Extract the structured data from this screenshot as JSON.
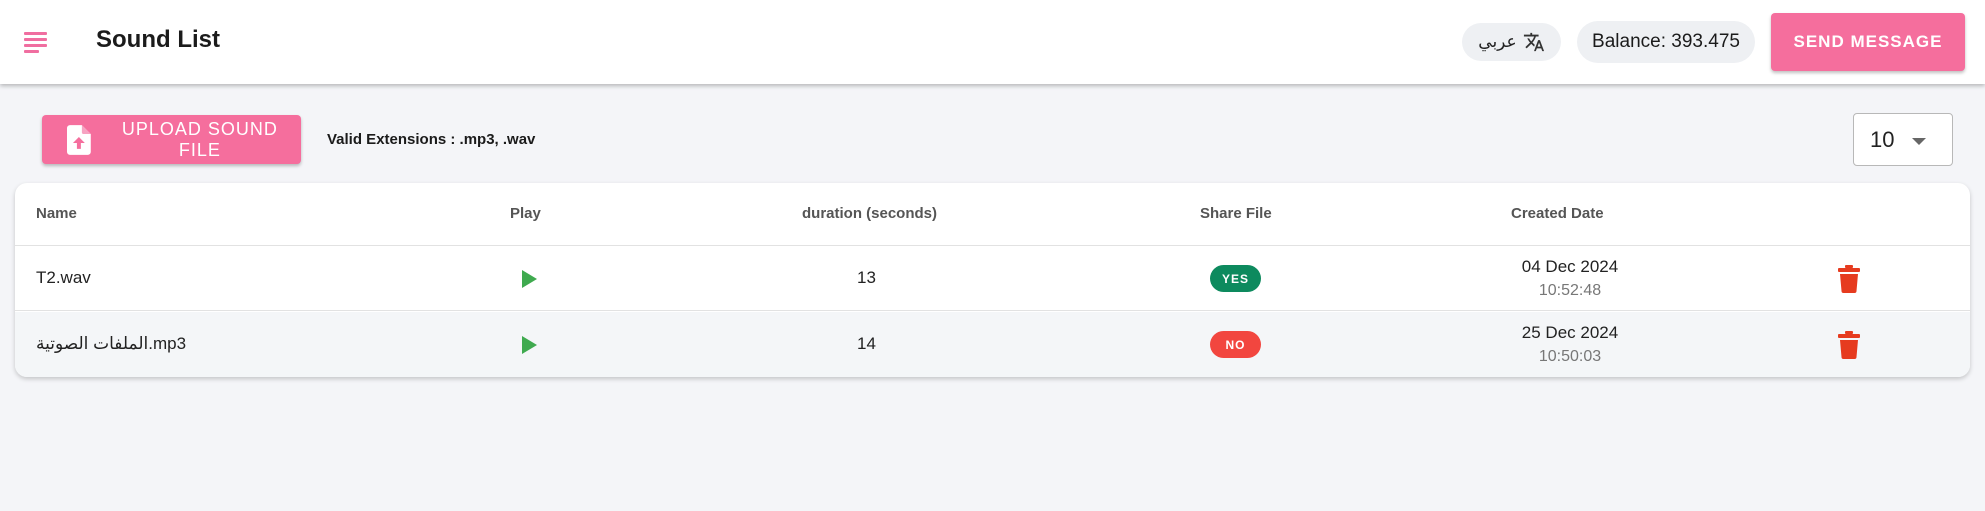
{
  "header": {
    "title": "Sound List",
    "language_label": "عربي",
    "balance_text": "Balance: 393.475",
    "send_button": "SEND MESSAGE"
  },
  "toolbar": {
    "upload_button": "UPLOAD SOUND FILE",
    "valid_extensions": "Valid Extensions : .mp3, .wav",
    "page_size": "10"
  },
  "colors": {
    "accent": "#f56e9d",
    "play": "#3faa4f",
    "yes_badge": "#0d8a5e",
    "no_badge": "#f2463f",
    "trash": "#e63b1f"
  },
  "table": {
    "columns": {
      "name": "Name",
      "play": "Play",
      "duration": "duration (seconds)",
      "share": "Share File",
      "created": "Created Date"
    },
    "rows": [
      {
        "name": "T2.wav",
        "duration": "13",
        "share": "YES",
        "date": "04 Dec 2024",
        "time": "10:52:48"
      },
      {
        "name": "الملفات الصوتية.mp3",
        "duration": "14",
        "share": "NO",
        "date": "25 Dec 2024",
        "time": "10:50:03"
      }
    ]
  }
}
